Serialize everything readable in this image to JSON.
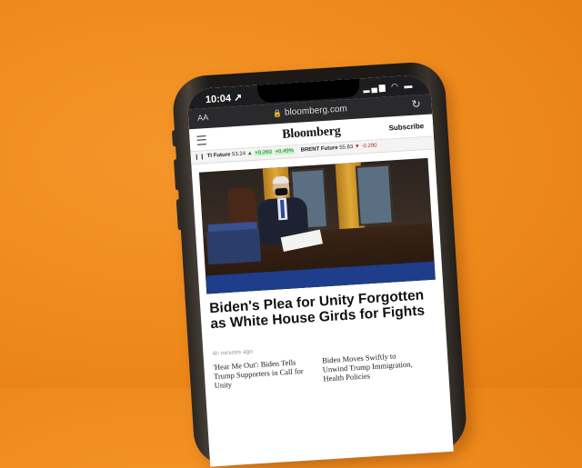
{
  "status_bar": {
    "time": "10:04",
    "time_arrow": "↗",
    "signal_wifi_battery": "▂▄▆ ◠ ▬"
  },
  "url_bar": {
    "text_size": "AA",
    "lock": "🔒",
    "url": "bloomberg.com",
    "reload": "↻"
  },
  "site_header": {
    "logo": "Bloomberg",
    "subscribe": "Subscribe"
  },
  "ticker": {
    "item1_name": "TI Future",
    "item1_value": "53.24",
    "item1_arrow": "▲",
    "item1_change": "+0.260",
    "item1_pct": "+0.49%",
    "item2_name": "BRENT Future",
    "item2_value": "55.83",
    "item2_arrow": "▼",
    "item2_change": "-0.290"
  },
  "article": {
    "headline": "Biden's Plea for Unity Forgotten as White House Girds for Fights",
    "timestamp": "4h minutes ago"
  },
  "related": [
    {
      "title": "'Hear Me Out': Biden Tells Trump Supporters in Call for Unity"
    },
    {
      "title": "Biden Moves Swiftly to Unwind Trump Immigration, Health Policies"
    }
  ]
}
